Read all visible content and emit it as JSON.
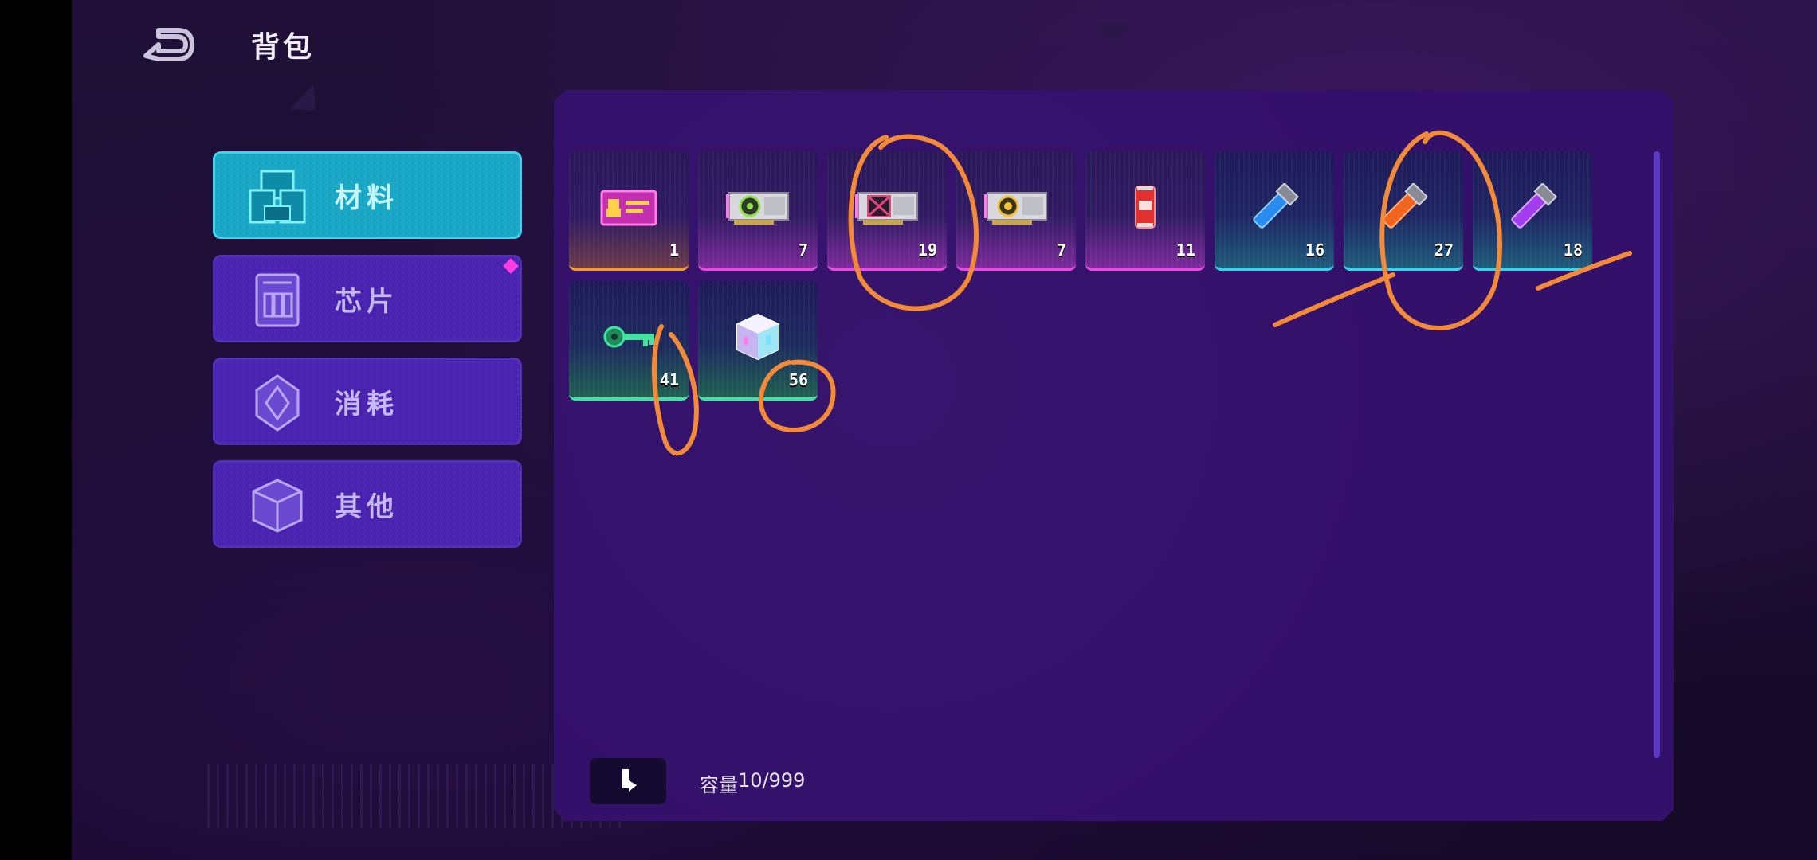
{
  "header": {
    "title": "背包",
    "back_icon": "back-arrow-icon"
  },
  "tabs": [
    {
      "label": "材料",
      "icon": "materials-icon",
      "active": true,
      "badge": false
    },
    {
      "label": "芯片",
      "icon": "chip-icon",
      "active": false,
      "badge": true
    },
    {
      "label": "消耗",
      "icon": "consumable-gem-icon",
      "active": false,
      "badge": false
    },
    {
      "label": "其他",
      "icon": "cube-icon",
      "active": false,
      "badge": false
    }
  ],
  "items": [
    {
      "icon": "id-card-icon",
      "count": "1",
      "rarity": "orange"
    },
    {
      "icon": "gpu-card-green-icon",
      "count": "7",
      "rarity": "pink"
    },
    {
      "icon": "gpu-card-red-icon",
      "count": "19",
      "rarity": "pink"
    },
    {
      "icon": "gpu-card-yellow-icon",
      "count": "7",
      "rarity": "pink"
    },
    {
      "icon": "soda-can-icon",
      "count": "11",
      "rarity": "pink"
    },
    {
      "icon": "blue-tube-icon",
      "count": "16",
      "rarity": "cyan"
    },
    {
      "icon": "orange-tube-icon",
      "count": "27",
      "rarity": "cyan"
    },
    {
      "icon": "purple-tube-icon",
      "count": "18",
      "rarity": "cyan"
    },
    {
      "icon": "green-key-icon",
      "count": "41",
      "rarity": "green"
    },
    {
      "icon": "holo-cube-icon",
      "count": "56",
      "rarity": "green"
    }
  ],
  "footer": {
    "sort_icon": "sort-down-icon",
    "capacity_label": "容量",
    "capacity_value": "10/999"
  },
  "colors": {
    "panel": "#33106a",
    "tab_active": "#1aa7c6",
    "tab_inactive": "#4a24b0",
    "annotation": "#f28a3a"
  }
}
